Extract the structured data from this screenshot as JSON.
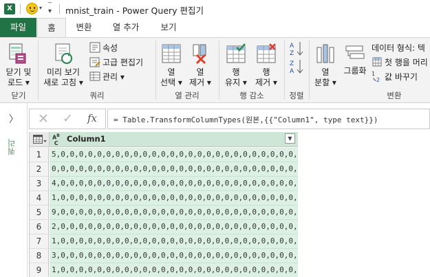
{
  "window": {
    "title": "mnist_train - Power Query 편집기"
  },
  "tabs": [
    {
      "label": "파일"
    },
    {
      "label": "홈"
    },
    {
      "label": "변환"
    },
    {
      "label": "열 추가"
    },
    {
      "label": "보기"
    }
  ],
  "ribbon": {
    "close_load": {
      "line1": "닫기 및",
      "line2": "로드 ▾",
      "group": "닫기"
    },
    "query": {
      "preview": {
        "line1": "미리 보기",
        "line2": "새로 고침 ▾"
      },
      "properties": "속성",
      "advanced_editor": "고급 편집기",
      "manage": "관리 ▾",
      "group": "쿼리"
    },
    "columns": {
      "choose": {
        "line1": "열",
        "line2": "선택 ▾"
      },
      "remove": {
        "line1": "열",
        "line2": "제거 ▾"
      },
      "group": "열 관리"
    },
    "rows": {
      "keep": {
        "line1": "행",
        "line2": "유지 ▾"
      },
      "remove": {
        "line1": "행",
        "line2": "제거 ▾"
      },
      "group": "행 감소"
    },
    "sort": {
      "group": "정렬"
    },
    "transform": {
      "split": {
        "line1": "열",
        "line2": "분할 ▾"
      },
      "group_by": "그룹화",
      "data_type": "데이터 형식: 텍",
      "first_row_header": "첫 행을 머리",
      "replace_values": "값 바꾸기",
      "group": "변환"
    }
  },
  "formula_bar": {
    "fx": "fx",
    "formula": "= Table.TransformColumnTypes(원본,{{\"Column1\", type text}})"
  },
  "side_panel": {
    "label": "쿼리",
    "toggle": "〉"
  },
  "grid": {
    "column_header": "Column1",
    "type_icon": "ABC",
    "rows": [
      {
        "n": "1",
        "v": "5,0,0,0,0,0,0,0,0,0,0,0,0,0,0,0,0,0,0,0,0,0,0,0,0,0,0,0,0,0,..."
      },
      {
        "n": "2",
        "v": "0,0,0,0,0,0,0,0,0,0,0,0,0,0,0,0,0,0,0,0,0,0,0,0,0,0,0,0,0,0,..."
      },
      {
        "n": "3",
        "v": "4,0,0,0,0,0,0,0,0,0,0,0,0,0,0,0,0,0,0,0,0,0,0,0,0,0,0,0,0,0,..."
      },
      {
        "n": "4",
        "v": "1,0,0,0,0,0,0,0,0,0,0,0,0,0,0,0,0,0,0,0,0,0,0,0,0,0,0,0,0,0,..."
      },
      {
        "n": "5",
        "v": "9,0,0,0,0,0,0,0,0,0,0,0,0,0,0,0,0,0,0,0,0,0,0,0,0,0,0,0,0,0,..."
      },
      {
        "n": "6",
        "v": "2,0,0,0,0,0,0,0,0,0,0,0,0,0,0,0,0,0,0,0,0,0,0,0,0,0,0,0,0,0,..."
      },
      {
        "n": "7",
        "v": "1,0,0,0,0,0,0,0,0,0,0,0,0,0,0,0,0,0,0,0,0,0,0,0,0,0,0,0,0,0,..."
      },
      {
        "n": "8",
        "v": "3,0,0,0,0,0,0,0,0,0,0,0,0,0,0,0,0,0,0,0,0,0,0,0,0,0,0,0,0,0,..."
      },
      {
        "n": "9",
        "v": "1,0,0,0,0,0,0,0,0,0,0,0,0,0,0,0,0,0,0,0,0,0,0,0,0,0,0,0,0,0,..."
      }
    ]
  },
  "colors": {
    "excel_green": "#217346",
    "row_green": "#dcf0e3",
    "ribbon_bg": "#f3f3f3"
  }
}
